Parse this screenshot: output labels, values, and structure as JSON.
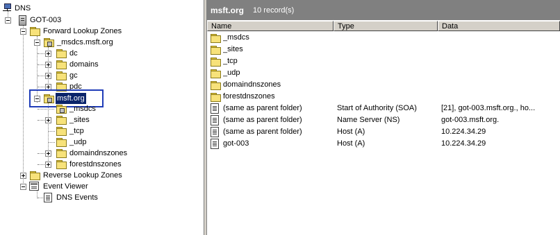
{
  "tree": {
    "root": "DNS",
    "server": "GOT-003",
    "forward_zones": "Forward Lookup Zones",
    "msdcs_zone": "_msdcs.msft.org",
    "msdcs_children": [
      "dc",
      "domains",
      "gc",
      "pdc"
    ],
    "selected_zone": "msft.org",
    "zone_children": [
      "_msdcs",
      "_sites",
      "_tcp",
      "_udp",
      "domaindnszones",
      "forestdnszones"
    ],
    "reverse_zones": "Reverse Lookup Zones",
    "event_viewer": "Event Viewer",
    "dns_events": "DNS Events"
  },
  "details": {
    "title": "msft.org",
    "count": "10 record(s)",
    "columns": [
      "Name",
      "Type",
      "Data"
    ],
    "rows": [
      {
        "icon": "folder-icon",
        "name": "_msdcs",
        "type": "",
        "data": ""
      },
      {
        "icon": "folder-icon",
        "name": "_sites",
        "type": "",
        "data": ""
      },
      {
        "icon": "folder-icon",
        "name": "_tcp",
        "type": "",
        "data": ""
      },
      {
        "icon": "folder-icon",
        "name": "_udp",
        "type": "",
        "data": ""
      },
      {
        "icon": "folder-icon",
        "name": "domaindnszones",
        "type": "",
        "data": ""
      },
      {
        "icon": "folder-icon",
        "name": "forestdnszones",
        "type": "",
        "data": ""
      },
      {
        "icon": "record-icon",
        "name": "(same as parent folder)",
        "type": "Start of Authority (SOA)",
        "data": "[21], got-003.msft.org., ho..."
      },
      {
        "icon": "record-icon",
        "name": "(same as parent folder)",
        "type": "Name Server (NS)",
        "data": "got-003.msft.org."
      },
      {
        "icon": "record-icon",
        "name": "(same as parent folder)",
        "type": "Host (A)",
        "data": "10.224.34.29"
      },
      {
        "icon": "record-icon",
        "name": "got-003",
        "type": "Host (A)",
        "data": "10.224.34.29"
      }
    ]
  },
  "colors": {
    "title_bar": "#808080",
    "highlight_box": "#1f3cb8",
    "selection": "#0a246a"
  }
}
